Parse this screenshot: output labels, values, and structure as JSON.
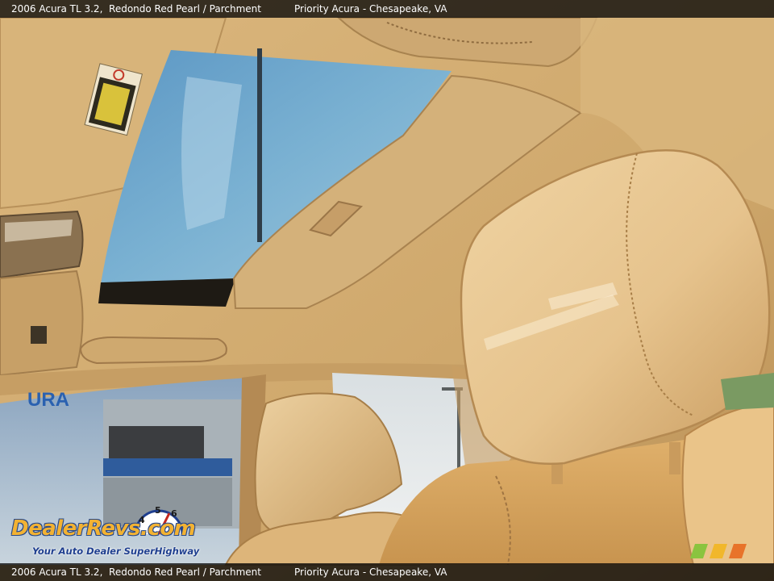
{
  "caption": {
    "vehicle": "2006 Acura TL 3.2,",
    "colors": "Redondo Red Pearl / Parchment",
    "dealer": "Priority Acura - Chesapeake, VA"
  },
  "watermark": {
    "brand": "DealerRevs.com",
    "tagline": "Your Auto Dealer SuperHighway",
    "dial_numbers": [
      "4",
      "5",
      "6"
    ]
  },
  "scene": {
    "sign_text": "URA",
    "colors": {
      "headliner": "#d2ad73",
      "leather": "#e8c48f",
      "sky": "#6fa8cc",
      "watermark_orange": "#f2b233",
      "watermark_blue": "#2a4a8a"
    }
  }
}
